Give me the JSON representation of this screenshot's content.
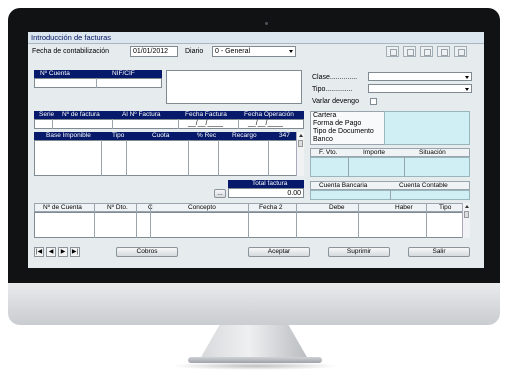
{
  "window": {
    "title": "Introducción de facturas"
  },
  "header": {
    "fecha_label": "Fecha de contabilización",
    "fecha_value": "01/01/2012",
    "diario_label": "Diario",
    "diario_value": "0 - General"
  },
  "cuenta_box": {
    "headers": [
      "Nº Cuenta",
      "NIF/CIF"
    ]
  },
  "right_options": {
    "clase_label": "Clase..............",
    "tipo_label": "Tipo..............",
    "devengo_label": "Varlar devengo"
  },
  "factura_row": {
    "headers": [
      "Serie",
      "Nº de factura",
      "Al Nº Factura",
      "Fecha Factura",
      "Fecha Operación"
    ],
    "fecha_factura_value": "__/__/____",
    "fecha_operacion_value": "__/__/____"
  },
  "cartera_panel": {
    "rows": [
      "Cartera",
      "Forma de Pago",
      "Tipo de Documento",
      "Banco"
    ]
  },
  "base_table": {
    "headers": [
      "Base Imponible",
      "Tipo",
      "Cuota",
      "% Rec",
      "Recargo",
      "347"
    ]
  },
  "vto_table": {
    "headers": [
      "F. Vto.",
      "Importe",
      "Situación"
    ]
  },
  "total": {
    "label": "Total factura",
    "value": "0.00",
    "ellipsis_button": "..."
  },
  "cuentas_panel": {
    "headers": [
      "Cuenta Bancaria",
      "Cuenta Contable"
    ]
  },
  "apuntes_table": {
    "headers": [
      "Nº de Cuenta",
      "Nº Dto.",
      "C",
      "Concepto",
      "Fecha 2",
      "Debe",
      "Haber",
      "Tipo"
    ]
  },
  "nav": {
    "first": "|◀",
    "prev": "◀",
    "next": "▶",
    "last": "▶|"
  },
  "buttons": {
    "cobros": "Cobros",
    "aceptar": "Aceptar",
    "suprimir": "Suprimir",
    "salir": "Salir"
  },
  "toolbar_icons": [
    "copy-icon",
    "paste-icon",
    "refresh-icon",
    "save-icon",
    "edit-icon"
  ],
  "colors": {
    "header_bg": "#06196a",
    "window_bg": "#e6ebee",
    "cyan_panel": "#cfeff4",
    "title_text": "#00155f"
  }
}
